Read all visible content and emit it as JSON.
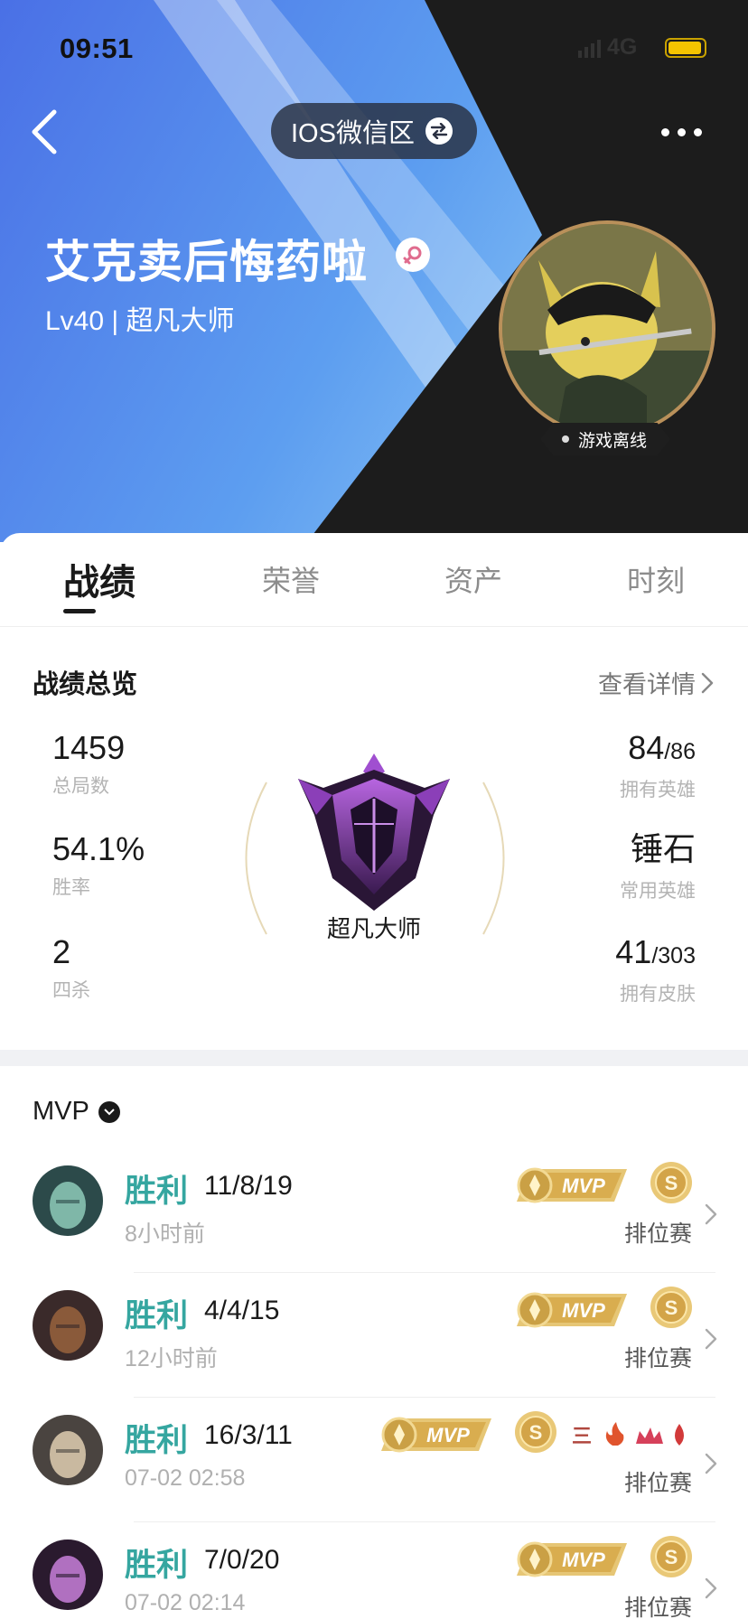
{
  "status_bar": {
    "time": "09:51",
    "network": "4G"
  },
  "header": {
    "server_label": "IOS微信区",
    "player_name": "艾克卖后悔药啦",
    "level_text": "Lv40 | 超凡大师",
    "online_status": "游戏离线"
  },
  "tabs": [
    {
      "label": "战绩",
      "active": true
    },
    {
      "label": "荣誉",
      "active": false
    },
    {
      "label": "资产",
      "active": false
    },
    {
      "label": "时刻",
      "active": false
    }
  ],
  "overview": {
    "title": "战绩总览",
    "detail_link": "查看详情",
    "rank_name": "超凡大师",
    "left_stats": [
      {
        "value": "1459",
        "label": "总局数"
      },
      {
        "value": "54.1%",
        "label": "胜率"
      },
      {
        "value": "2",
        "label": "四杀"
      }
    ],
    "right_stats": [
      {
        "value": "84",
        "suffix": "/86",
        "label": "拥有英雄"
      },
      {
        "value": "锤石",
        "suffix": "",
        "label": "常用英雄"
      },
      {
        "value": "41",
        "suffix": "/303",
        "label": "拥有皮肤"
      }
    ]
  },
  "mvp_section": {
    "title": "MVP",
    "badge_text": "MVP",
    "s_badge_text": "S",
    "achievement_text": "三",
    "matches": [
      {
        "result": "胜利",
        "kda": "11/8/19",
        "time": "8小时前",
        "mode": "排位赛"
      },
      {
        "result": "胜利",
        "kda": "4/4/15",
        "time": "12小时前",
        "mode": "排位赛"
      },
      {
        "result": "胜利",
        "kda": "16/3/11",
        "time": "07-02 02:58",
        "mode": "排位赛"
      },
      {
        "result": "胜利",
        "kda": "7/0/20",
        "time": "07-02 02:14",
        "mode": "排位赛"
      }
    ]
  },
  "colors": {
    "win": "#35a6a0",
    "header_blue": "#4a78e0",
    "header_dark": "#1c1c1c",
    "accent_gold": "#c9a35a"
  }
}
